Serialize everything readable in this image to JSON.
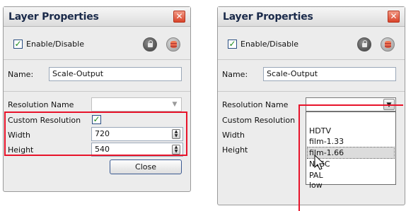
{
  "panels": [
    {
      "title": "Layer Properties",
      "close_glyph": "✕",
      "enable_label": "Enable/Disable",
      "enable_checked": true,
      "name_label": "Name:",
      "name_value": "Scale-Output",
      "resolution_label": "Resolution Name",
      "resolution_value": "",
      "custom_res_label": "Custom Resolution",
      "custom_res_checked": true,
      "width_label": "Width",
      "width_value": "720",
      "height_label": "Height",
      "height_value": "540",
      "close_button": "Close"
    },
    {
      "title": "Layer Properties",
      "close_glyph": "✕",
      "enable_label": "Enable/Disable",
      "enable_checked": true,
      "name_label": "Name:",
      "name_value": "Scale-Output",
      "resolution_label": "Resolution Name",
      "custom_res_label": "Custom Resolution",
      "width_label": "Width",
      "height_label": "Height",
      "dropdown_options": [
        "HDTV",
        "film-1.33",
        "film-1.66",
        "NTSC",
        "PAL",
        "low"
      ],
      "dropdown_selected": "film-1.66"
    }
  ],
  "colors": {
    "highlight": "#e8132a",
    "title_text": "#1a2a4a",
    "close_red": "#d9442a"
  },
  "icons": {
    "lock": "lock-icon",
    "database": "database-icon",
    "check": "checkmark-icon",
    "dropdown": "chevron-down-icon",
    "spinner": "spinner-arrows-icon",
    "cursor": "mouse-pointer-icon"
  }
}
